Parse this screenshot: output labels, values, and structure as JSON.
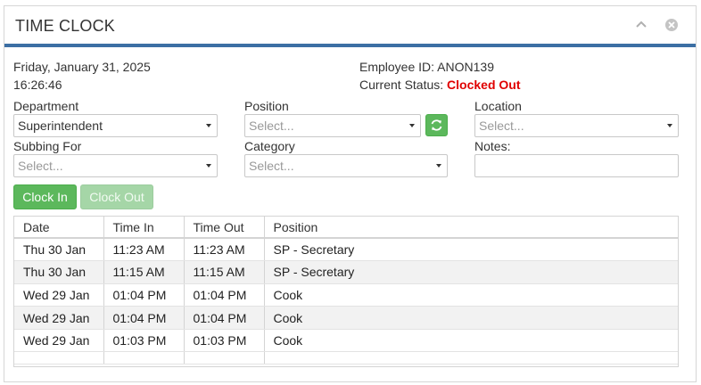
{
  "panel": {
    "title": "TIME CLOCK",
    "collapse_icon": "chevron-up-icon",
    "close_icon": "close-circle-icon"
  },
  "info": {
    "date": "Friday, January 31, 2025",
    "time": "16:26:46",
    "employee_label": "Employee ID:",
    "employee_id": "ANON139",
    "status_label": "Current Status:",
    "status_value": "Clocked Out",
    "status_color": "#e00000"
  },
  "form": {
    "department_label": "Department",
    "department_value": "Superintendent",
    "position_label": "Position",
    "position_placeholder": "Select...",
    "location_label": "Location",
    "location_placeholder": "Select...",
    "subbing_label": "Subbing For",
    "subbing_placeholder": "Select...",
    "category_label": "Category",
    "category_placeholder": "Select...",
    "notes_label": "Notes:",
    "notes_value": "",
    "refresh_icon": "refresh-icon"
  },
  "buttons": {
    "clock_in": "Clock In",
    "clock_out": "Clock Out"
  },
  "grid": {
    "columns": [
      "Date",
      "Time In",
      "Time Out",
      "Position"
    ],
    "rows": [
      [
        "Thu 30 Jan",
        "11:23 AM",
        "11:23 AM",
        "SP - Secretary"
      ],
      [
        "Thu 30 Jan",
        "11:15 AM",
        "11:15 AM",
        "SP - Secretary"
      ],
      [
        "Wed 29 Jan",
        "01:04 PM",
        "01:04 PM",
        "Cook"
      ],
      [
        "Wed 29 Jan",
        "01:04 PM",
        "01:04 PM",
        "Cook"
      ],
      [
        "Wed 29 Jan",
        "01:03 PM",
        "01:03 PM",
        "Cook"
      ]
    ]
  },
  "colors": {
    "accent": "#3c6fa4",
    "button_green": "#5cb85c",
    "button_green_disabled": "#a5d6a7"
  }
}
